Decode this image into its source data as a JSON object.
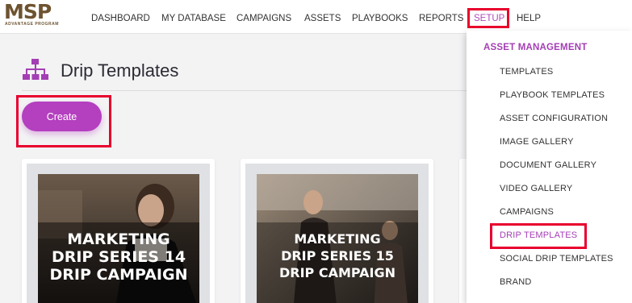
{
  "logo": {
    "main": "MSP",
    "sub": "ADVANTAGE PROGRAM"
  },
  "nav": {
    "dashboard": "DASHBOARD",
    "my_database": "MY DATABASE",
    "campaigns": "CAMPAIGNS",
    "assets": "ASSETS",
    "playbooks": "PLAYBOOKS",
    "reports": "REPORTS",
    "setup": "SETUP",
    "help": "HELP"
  },
  "page": {
    "title": "Drip Templates",
    "icon": "sitemap-icon",
    "create_label": "Create"
  },
  "cards": [
    {
      "line1": "MARKETING",
      "line2": "DRIP SERIES 14",
      "line3": "DRIP CAMPAIGN"
    },
    {
      "line1": "MARKETING",
      "line2": "DRIP SERIES 15",
      "line3": "DRIP CAMPAIGN"
    }
  ],
  "setup_menu": {
    "header": "ASSET MANAGEMENT",
    "items": [
      "TEMPLATES",
      "PLAYBOOK TEMPLATES",
      "ASSET CONFIGURATION",
      "IMAGE GALLERY",
      "DOCUMENT GALLERY",
      "VIDEO GALLERY",
      "CAMPAIGNS",
      "DRIP TEMPLATES",
      "SOCIAL DRIP TEMPLATES",
      "BRAND"
    ]
  },
  "colors": {
    "accent": "#b43fbf",
    "highlight": "#e8002d",
    "logo": "#6e5330"
  }
}
